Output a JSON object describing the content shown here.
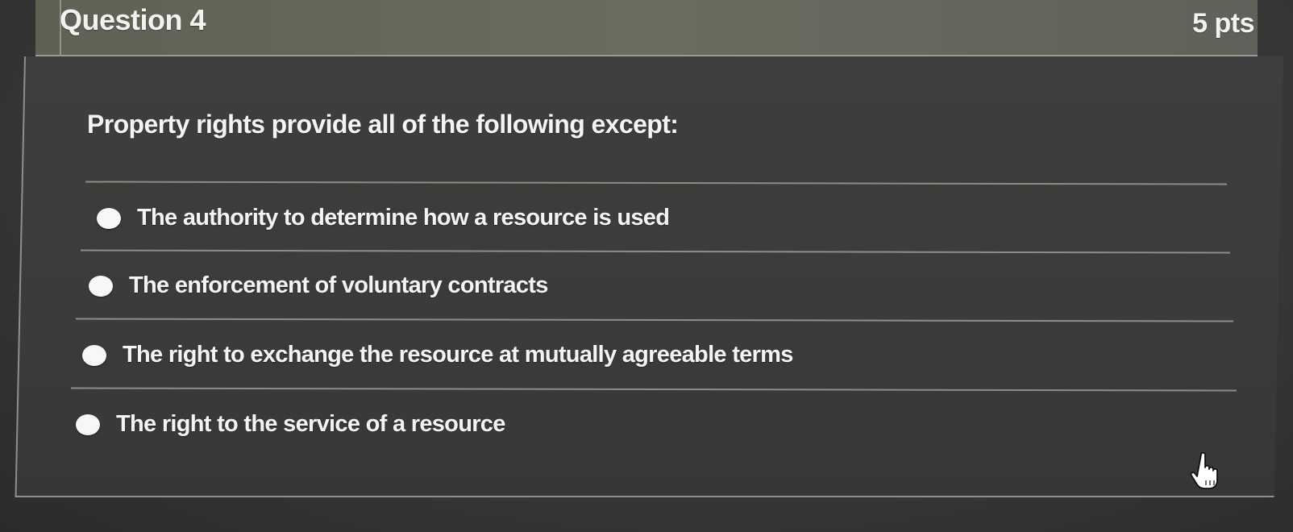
{
  "question": {
    "title": "Question 4",
    "points": "5 pts",
    "prompt": "Property rights provide all of the following except:",
    "answers": [
      {
        "label": "The authority to determine how a resource is used"
      },
      {
        "label": "The enforcement of voluntary contracts"
      },
      {
        "label": "The right to exchange the resource at mutually agreeable terms"
      },
      {
        "label": "The right to the service of a resource"
      }
    ]
  },
  "cursor": {
    "icon": "hand-pointer-icon"
  },
  "colors": {
    "header_bg": "#65685b",
    "body_bg": "#3b3d3c",
    "text": "#f4f4f2",
    "radio": "#f7f7f5"
  }
}
